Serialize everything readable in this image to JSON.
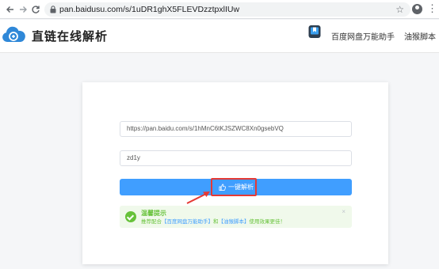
{
  "browser": {
    "back_icon": "arrow-left-icon",
    "forward_icon": "arrow-right-icon",
    "reload_icon": "reload-icon",
    "url": "pan.baidusu.com/s/1uDR1ghX5FLEVDzztpxlIUw",
    "star_icon": "star-icon",
    "account_icon": "account-icon",
    "menu_icon": "kebab-menu-icon"
  },
  "header": {
    "site_title": "直链在线解析",
    "logo_icon": "cloud-logo-icon",
    "link1_icon": "bookmark-app-icon",
    "link1_label": "百度网盘万能助手",
    "link2_label": "油猴脚本"
  },
  "form": {
    "link_value": "https://pan.baidu.com/s/1hMnC6tKJSZWC8Xn0gsebVQ",
    "code_value": "zd1y",
    "parse_label": "一键解析",
    "parse_icon": "thumbs-up-icon"
  },
  "alert": {
    "title": "温馨提示",
    "text_prefix": "推荐配合",
    "link1": "【百度网盘万能助手】",
    "text_mid": "和",
    "link2": "【油猴脚本】",
    "text_suffix": "使用效果更佳！",
    "close": "×"
  },
  "colors": {
    "primary": "#409eff",
    "success": "#67c23a",
    "success_bg": "#f0f9eb",
    "annotation_red": "#e53935"
  }
}
